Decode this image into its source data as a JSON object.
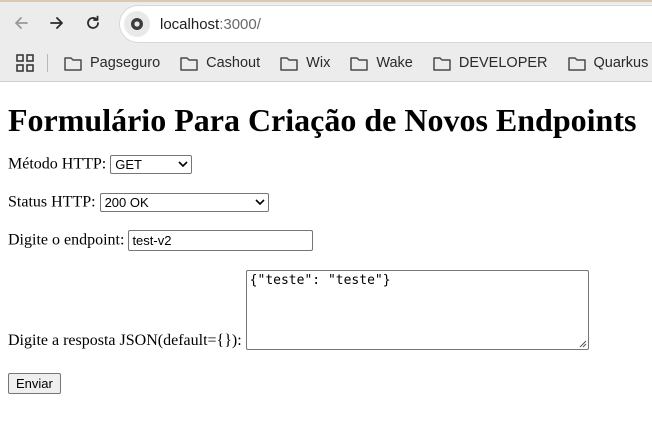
{
  "browser": {
    "url_host": "localhost",
    "url_path": ":3000/",
    "bookmarks": [
      "Pagseguro",
      "Cashout",
      "Wix",
      "Wake",
      "DEVELOPER",
      "Quarkus"
    ]
  },
  "form": {
    "title": "Formulário Para Criação de Novos Endpoints",
    "method_label": "Método HTTP:",
    "method_value": "GET",
    "status_label": "Status HTTP:",
    "status_value": "200 OK",
    "endpoint_label": "Digite o endpoint:",
    "endpoint_value": "test-v2",
    "response_label": "Digite a resposta JSON(default={}):",
    "response_value": "{\"teste\": \"teste\"}",
    "submit_label": "Enviar"
  }
}
